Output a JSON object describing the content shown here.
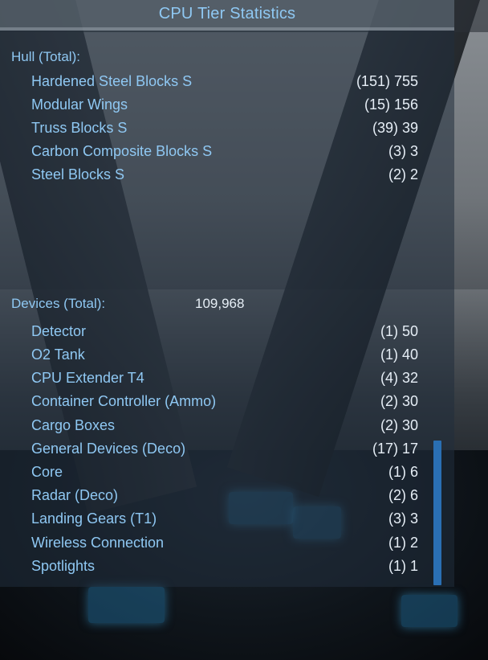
{
  "title": "CPU Tier Statistics",
  "hull": {
    "header": "Hull (Total):",
    "items": [
      {
        "label": "Hardened Steel Blocks S",
        "value": "(151) 755"
      },
      {
        "label": "Modular Wings",
        "value": "(15) 156"
      },
      {
        "label": "Truss Blocks S",
        "value": "(39) 39"
      },
      {
        "label": "Carbon Composite Blocks S",
        "value": "(3) 3"
      },
      {
        "label": "Steel Blocks S",
        "value": "(2) 2"
      }
    ]
  },
  "devices": {
    "header": "Devices (Total):",
    "total": "109,968",
    "items": [
      {
        "label": "Detector",
        "value": "(1) 50"
      },
      {
        "label": "O2 Tank",
        "value": "(1) 40"
      },
      {
        "label": "CPU Extender T4",
        "value": "(4) 32"
      },
      {
        "label": "Container Controller (Ammo)",
        "value": "(2) 30"
      },
      {
        "label": "Cargo Boxes",
        "value": "(2) 30"
      },
      {
        "label": "General Devices (Deco)",
        "value": "(17) 17"
      },
      {
        "label": "Core",
        "value": "(1) 6"
      },
      {
        "label": "Radar (Deco)",
        "value": "(2) 6"
      },
      {
        "label": "Landing Gears (T1)",
        "value": "(3) 3"
      },
      {
        "label": "Wireless Connection",
        "value": "(1) 2"
      },
      {
        "label": "Spotlights",
        "value": "(1) 1"
      }
    ]
  },
  "colors": {
    "accent": "#8fc8f3",
    "value": "#e6eef6",
    "scrollbar": "#2a6fb3"
  }
}
